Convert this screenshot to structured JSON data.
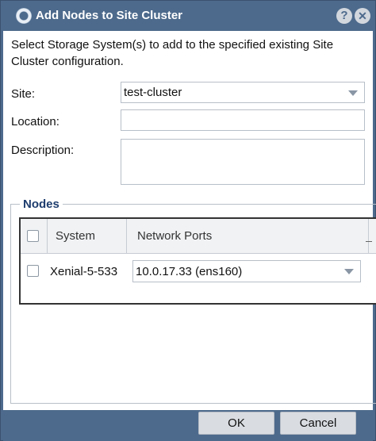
{
  "dialog": {
    "title": "Add Nodes to Site Cluster",
    "help_label": "?",
    "close_label": "✕"
  },
  "form": {
    "intro": "Select Storage System(s) to add to the specified existing Site Cluster configuration.",
    "site_label": "Site:",
    "site_value": "test-cluster",
    "location_label": "Location:",
    "location_value": "",
    "description_label": "Description:",
    "description_value": ""
  },
  "nodes": {
    "legend": "Nodes",
    "columns": [
      "System",
      "Network Ports"
    ],
    "rows": [
      {
        "checked": false,
        "system": "Xenial-5-533",
        "network_port": "10.0.17.33 (ens160)"
      }
    ]
  },
  "footer": {
    "ok_label": "OK",
    "cancel_label": "Cancel"
  }
}
